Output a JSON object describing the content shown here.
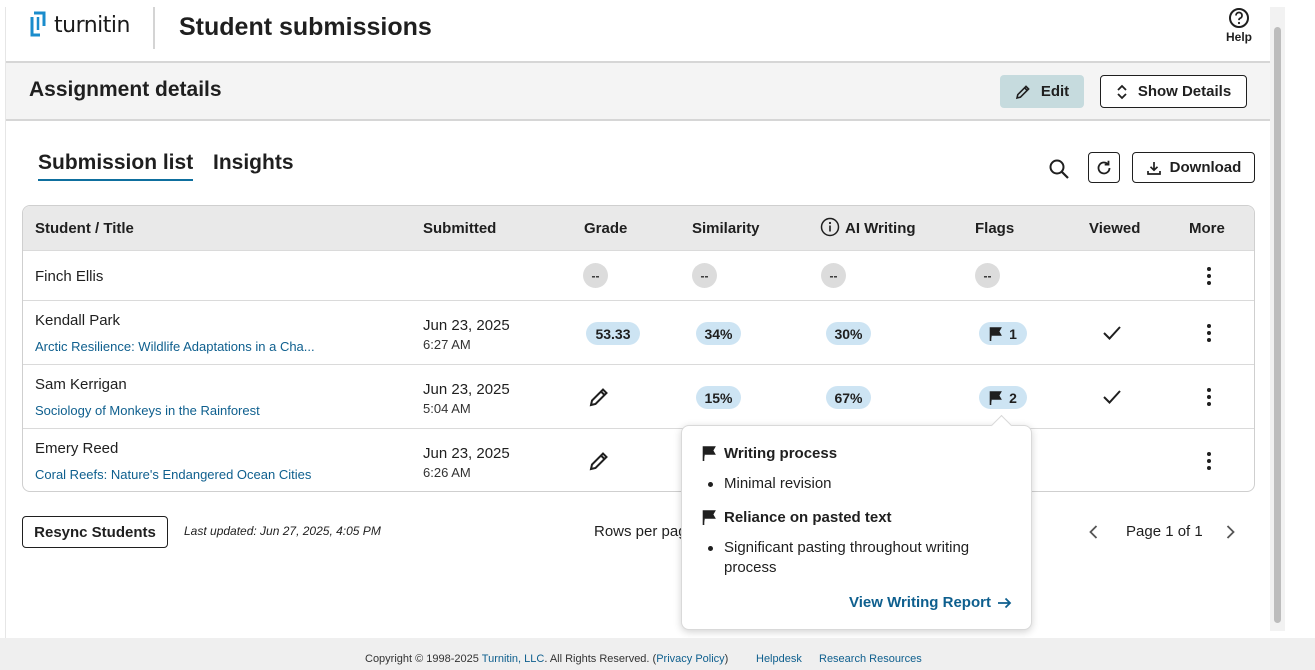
{
  "header": {
    "logo_text": "turnitin",
    "page_title": "Student submissions",
    "help_label": "Help"
  },
  "assignment": {
    "title": "Assignment details",
    "edit_label": "Edit",
    "show_details_label": "Show Details"
  },
  "tabs": [
    {
      "label": "Submission list",
      "active": true
    },
    {
      "label": "Insights",
      "active": false
    }
  ],
  "toolbar": {
    "download_label": "Download"
  },
  "table": {
    "columns": [
      "Student / Title",
      "Submitted",
      "Grade",
      "Similarity",
      "AI Writing",
      "Flags",
      "Viewed",
      "More"
    ],
    "rows": [
      {
        "name": "Finch Ellis",
        "title": "",
        "date": "",
        "time": "",
        "grade": "--",
        "similarity": "--",
        "ai": "--",
        "flags": "--",
        "viewed": false
      },
      {
        "name": "Kendall Park",
        "title": "Arctic Resilience: Wildlife Adaptations in a Cha...",
        "date": "Jun 23, 2025",
        "time": "6:27 AM",
        "grade": "53.33",
        "similarity": "34%",
        "ai": "30%",
        "flags": "1",
        "viewed": true
      },
      {
        "name": "Sam Kerrigan",
        "title": "Sociology of Monkeys in the Rainforest",
        "date": "Jun 23, 2025",
        "time": "5:04 AM",
        "grade": "",
        "similarity": "15%",
        "ai": "67%",
        "flags": "2",
        "viewed": true
      },
      {
        "name": "Emery Reed",
        "title": "Coral Reefs: Nature's Endangered Ocean Cities",
        "date": "Jun 23, 2025",
        "time": "6:26 AM",
        "grade": "",
        "similarity": "",
        "ai": "",
        "flags": "",
        "viewed": false
      }
    ]
  },
  "footer_bar": {
    "resync_label": "Resync Students",
    "last_updated": "Last updated: Jun 27, 2025, 4:05 PM",
    "rows_per_page": "Rows per pag",
    "page_text": "Page 1 of 1"
  },
  "popover": {
    "section1_title": "Writing process",
    "section1_item": "Minimal revision",
    "section2_title": "Reliance on pasted text",
    "section2_item": "Significant pasting throughout writing process",
    "link_label": "View Writing Report"
  },
  "page_footer": {
    "copyright_prefix": "Copyright © 1998-2025 ",
    "company": "Turnitin, LLC",
    "rights": ". All Rights Reserved. (",
    "privacy": "Privacy Policy",
    "close_paren": ")",
    "helpdesk": "Helpdesk",
    "research": "Research Resources"
  },
  "colors": {
    "accent": "#0e6f9e",
    "link": "#0e5f8e",
    "pill_bg": "#cde4f3",
    "edit_bg": "#c6dbde"
  },
  "icons": [
    "turnitin-logo-icon",
    "help-circle-icon",
    "pencil-icon",
    "expand-icon",
    "search-icon",
    "refresh-icon",
    "download-icon",
    "info-icon",
    "flag-icon",
    "checkmark-icon",
    "kebab-icon",
    "arrow-right-icon",
    "chevron-left-icon",
    "chevron-right-icon"
  ]
}
